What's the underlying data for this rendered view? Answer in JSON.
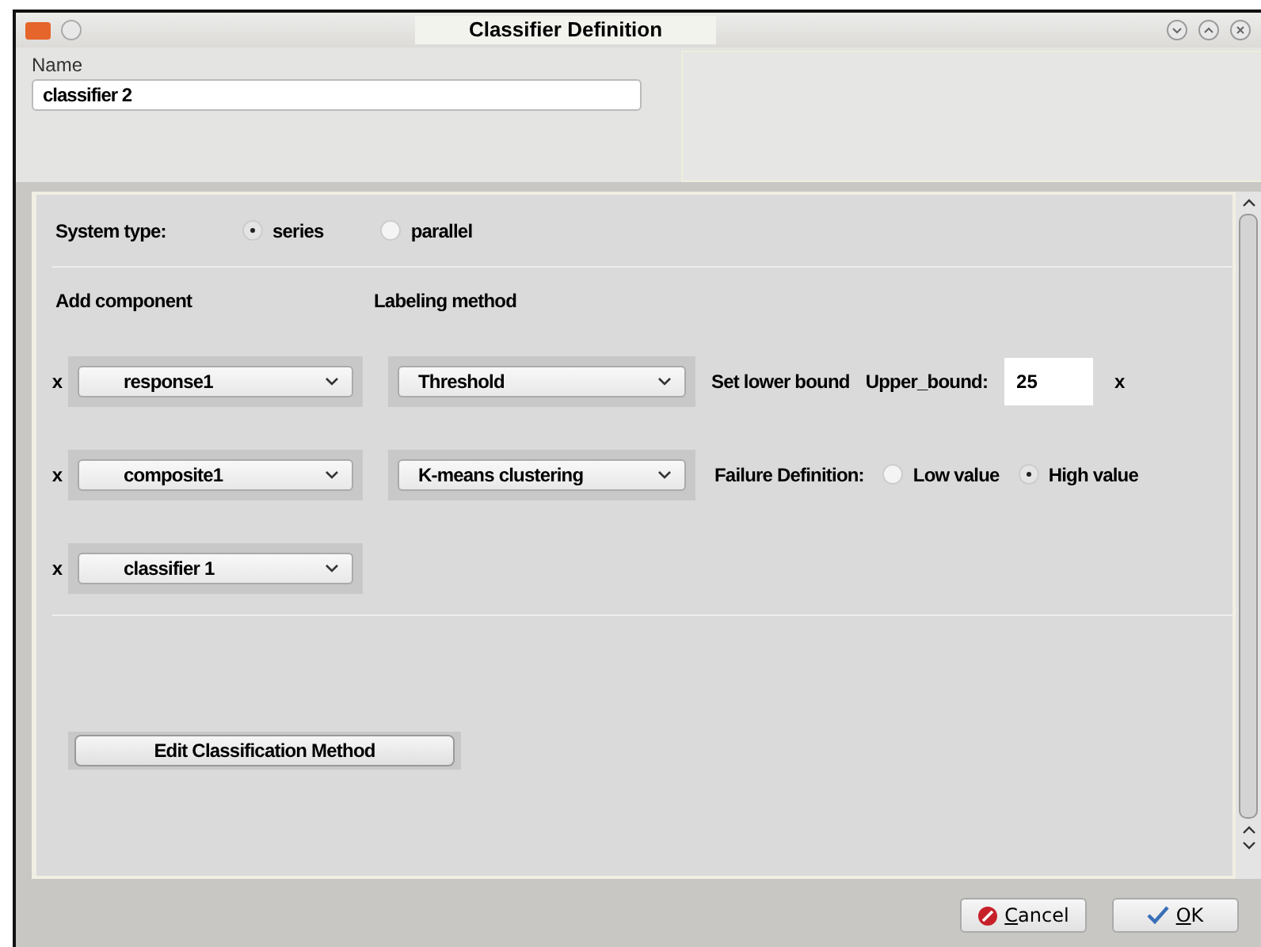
{
  "window": {
    "title": "Classifier Definition"
  },
  "name": {
    "label": "Name",
    "value": "classifier 2"
  },
  "system_type": {
    "label": "System type:",
    "options": [
      {
        "label": "series",
        "selected": true
      },
      {
        "label": "parallel",
        "selected": false
      }
    ]
  },
  "headers": {
    "add_component": "Add component",
    "labeling_method": "Labeling method"
  },
  "rows": [
    {
      "remove": "x",
      "component": "response1",
      "method": "Threshold",
      "details": {
        "kind": "bounds",
        "lower_button": "Set lower bound",
        "upper_label": "Upper_bound:",
        "upper_value": "25",
        "clear": "x"
      }
    },
    {
      "remove": "x",
      "component": "composite1",
      "method": "K-means clustering",
      "details": {
        "kind": "failure",
        "label": "Failure Definition:",
        "options": [
          {
            "label": "Low value",
            "selected": false
          },
          {
            "label": "High value",
            "selected": true
          }
        ]
      }
    },
    {
      "remove": "x",
      "component": "classifier 1"
    }
  ],
  "edit_button": "Edit Classification Method",
  "buttons": {
    "cancel": "Cancel",
    "ok": "OK"
  }
}
